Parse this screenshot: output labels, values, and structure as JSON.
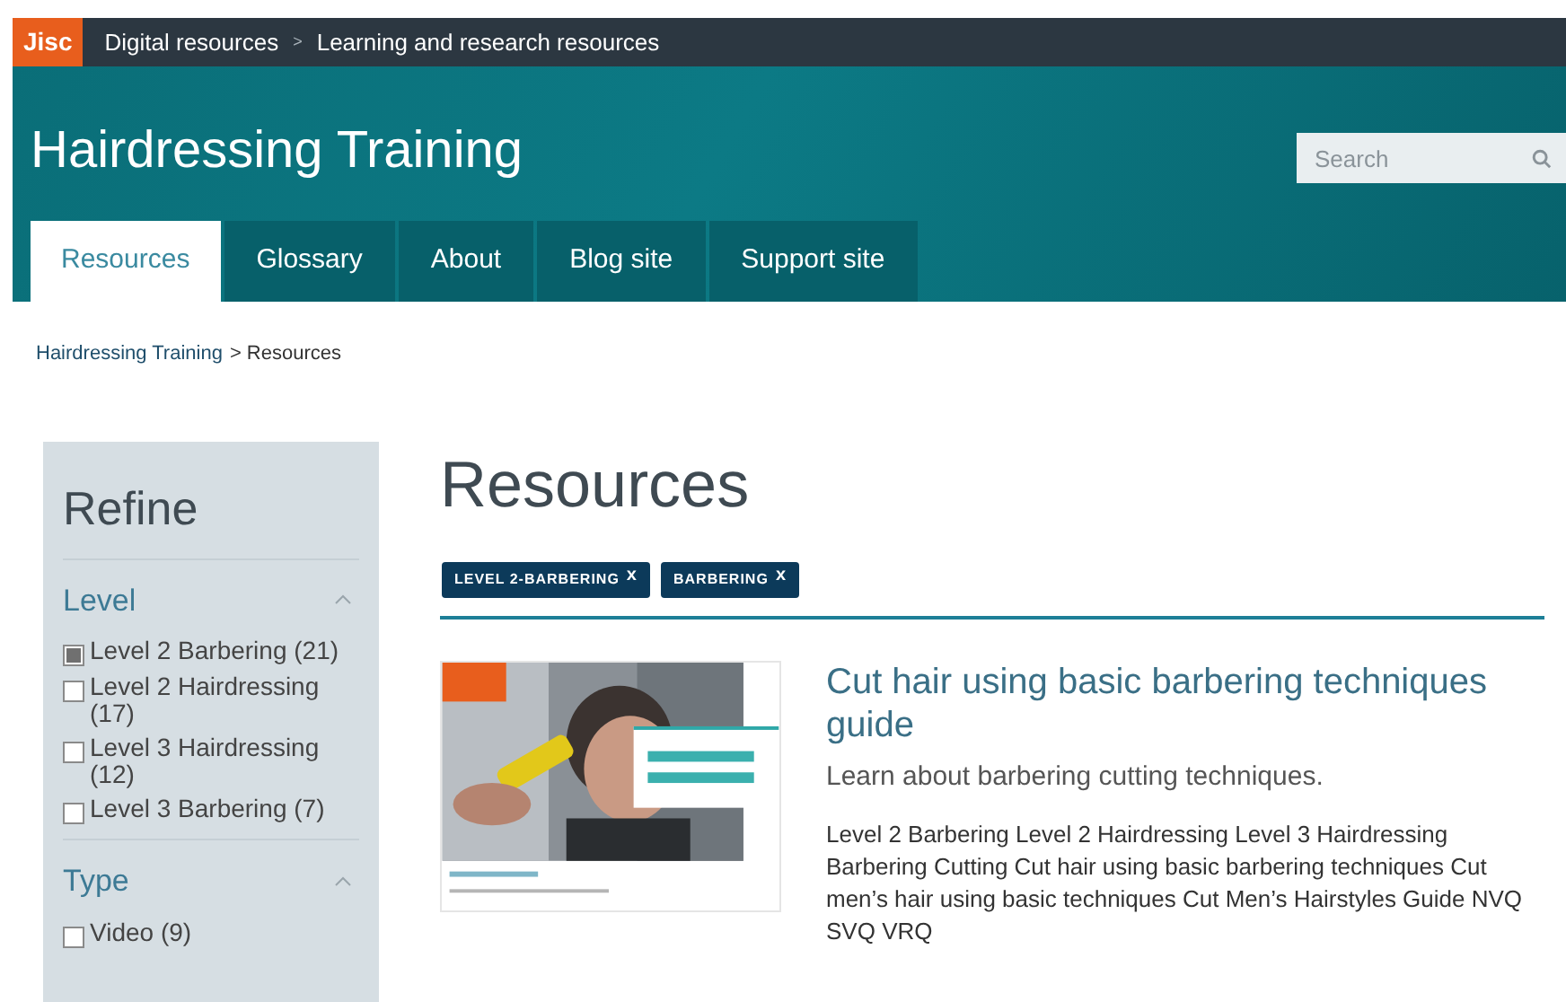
{
  "top_bar": {
    "logo": "Jisc",
    "breadcrumb": [
      "Digital resources",
      "Learning and research resources"
    ],
    "separator": ">"
  },
  "header": {
    "title": "Hairdressing Training",
    "search": {
      "placeholder": "Search"
    }
  },
  "tabs": [
    {
      "label": "Resources",
      "selected": true
    },
    {
      "label": "Glossary",
      "selected": false
    },
    {
      "label": "About",
      "selected": false
    },
    {
      "label": "Blog site",
      "selected": false
    },
    {
      "label": "Support site",
      "selected": false
    }
  ],
  "breadcrumb": {
    "link": "Hairdressing Training",
    "current": "> Resources"
  },
  "sidebar": {
    "title": "Refine",
    "groups": [
      {
        "title": "Level",
        "expanded": true,
        "options": [
          {
            "label": "Level 2 Barbering (21)",
            "checked": true
          },
          {
            "label": "Level 2 Hairdressing (17)",
            "checked": false
          },
          {
            "label": "Level 3 Hairdressing (12)",
            "checked": false
          },
          {
            "label": "Level 3 Barbering (7)",
            "checked": false
          }
        ]
      },
      {
        "title": "Type",
        "expanded": true,
        "options": [
          {
            "label": "Video (9)",
            "checked": false
          }
        ]
      }
    ]
  },
  "main": {
    "heading": "Resources",
    "filters": [
      {
        "label": "LEVEL 2-BARBERING",
        "remove": "x"
      },
      {
        "label": "BARBERING",
        "remove": "x"
      }
    ],
    "results": [
      {
        "title": "Cut hair using basic barbering techniques guide",
        "summary": "Learn about barbering cutting techniques.",
        "tags": "Level 2 Barbering Level 2 Hairdressing Level 3 Hairdressing Barbering Cutting Cut hair using basic barbering techniques Cut men’s hair using basic techniques Cut Men’s Hairstyles Guide NVQ SVQ VRQ"
      }
    ]
  }
}
